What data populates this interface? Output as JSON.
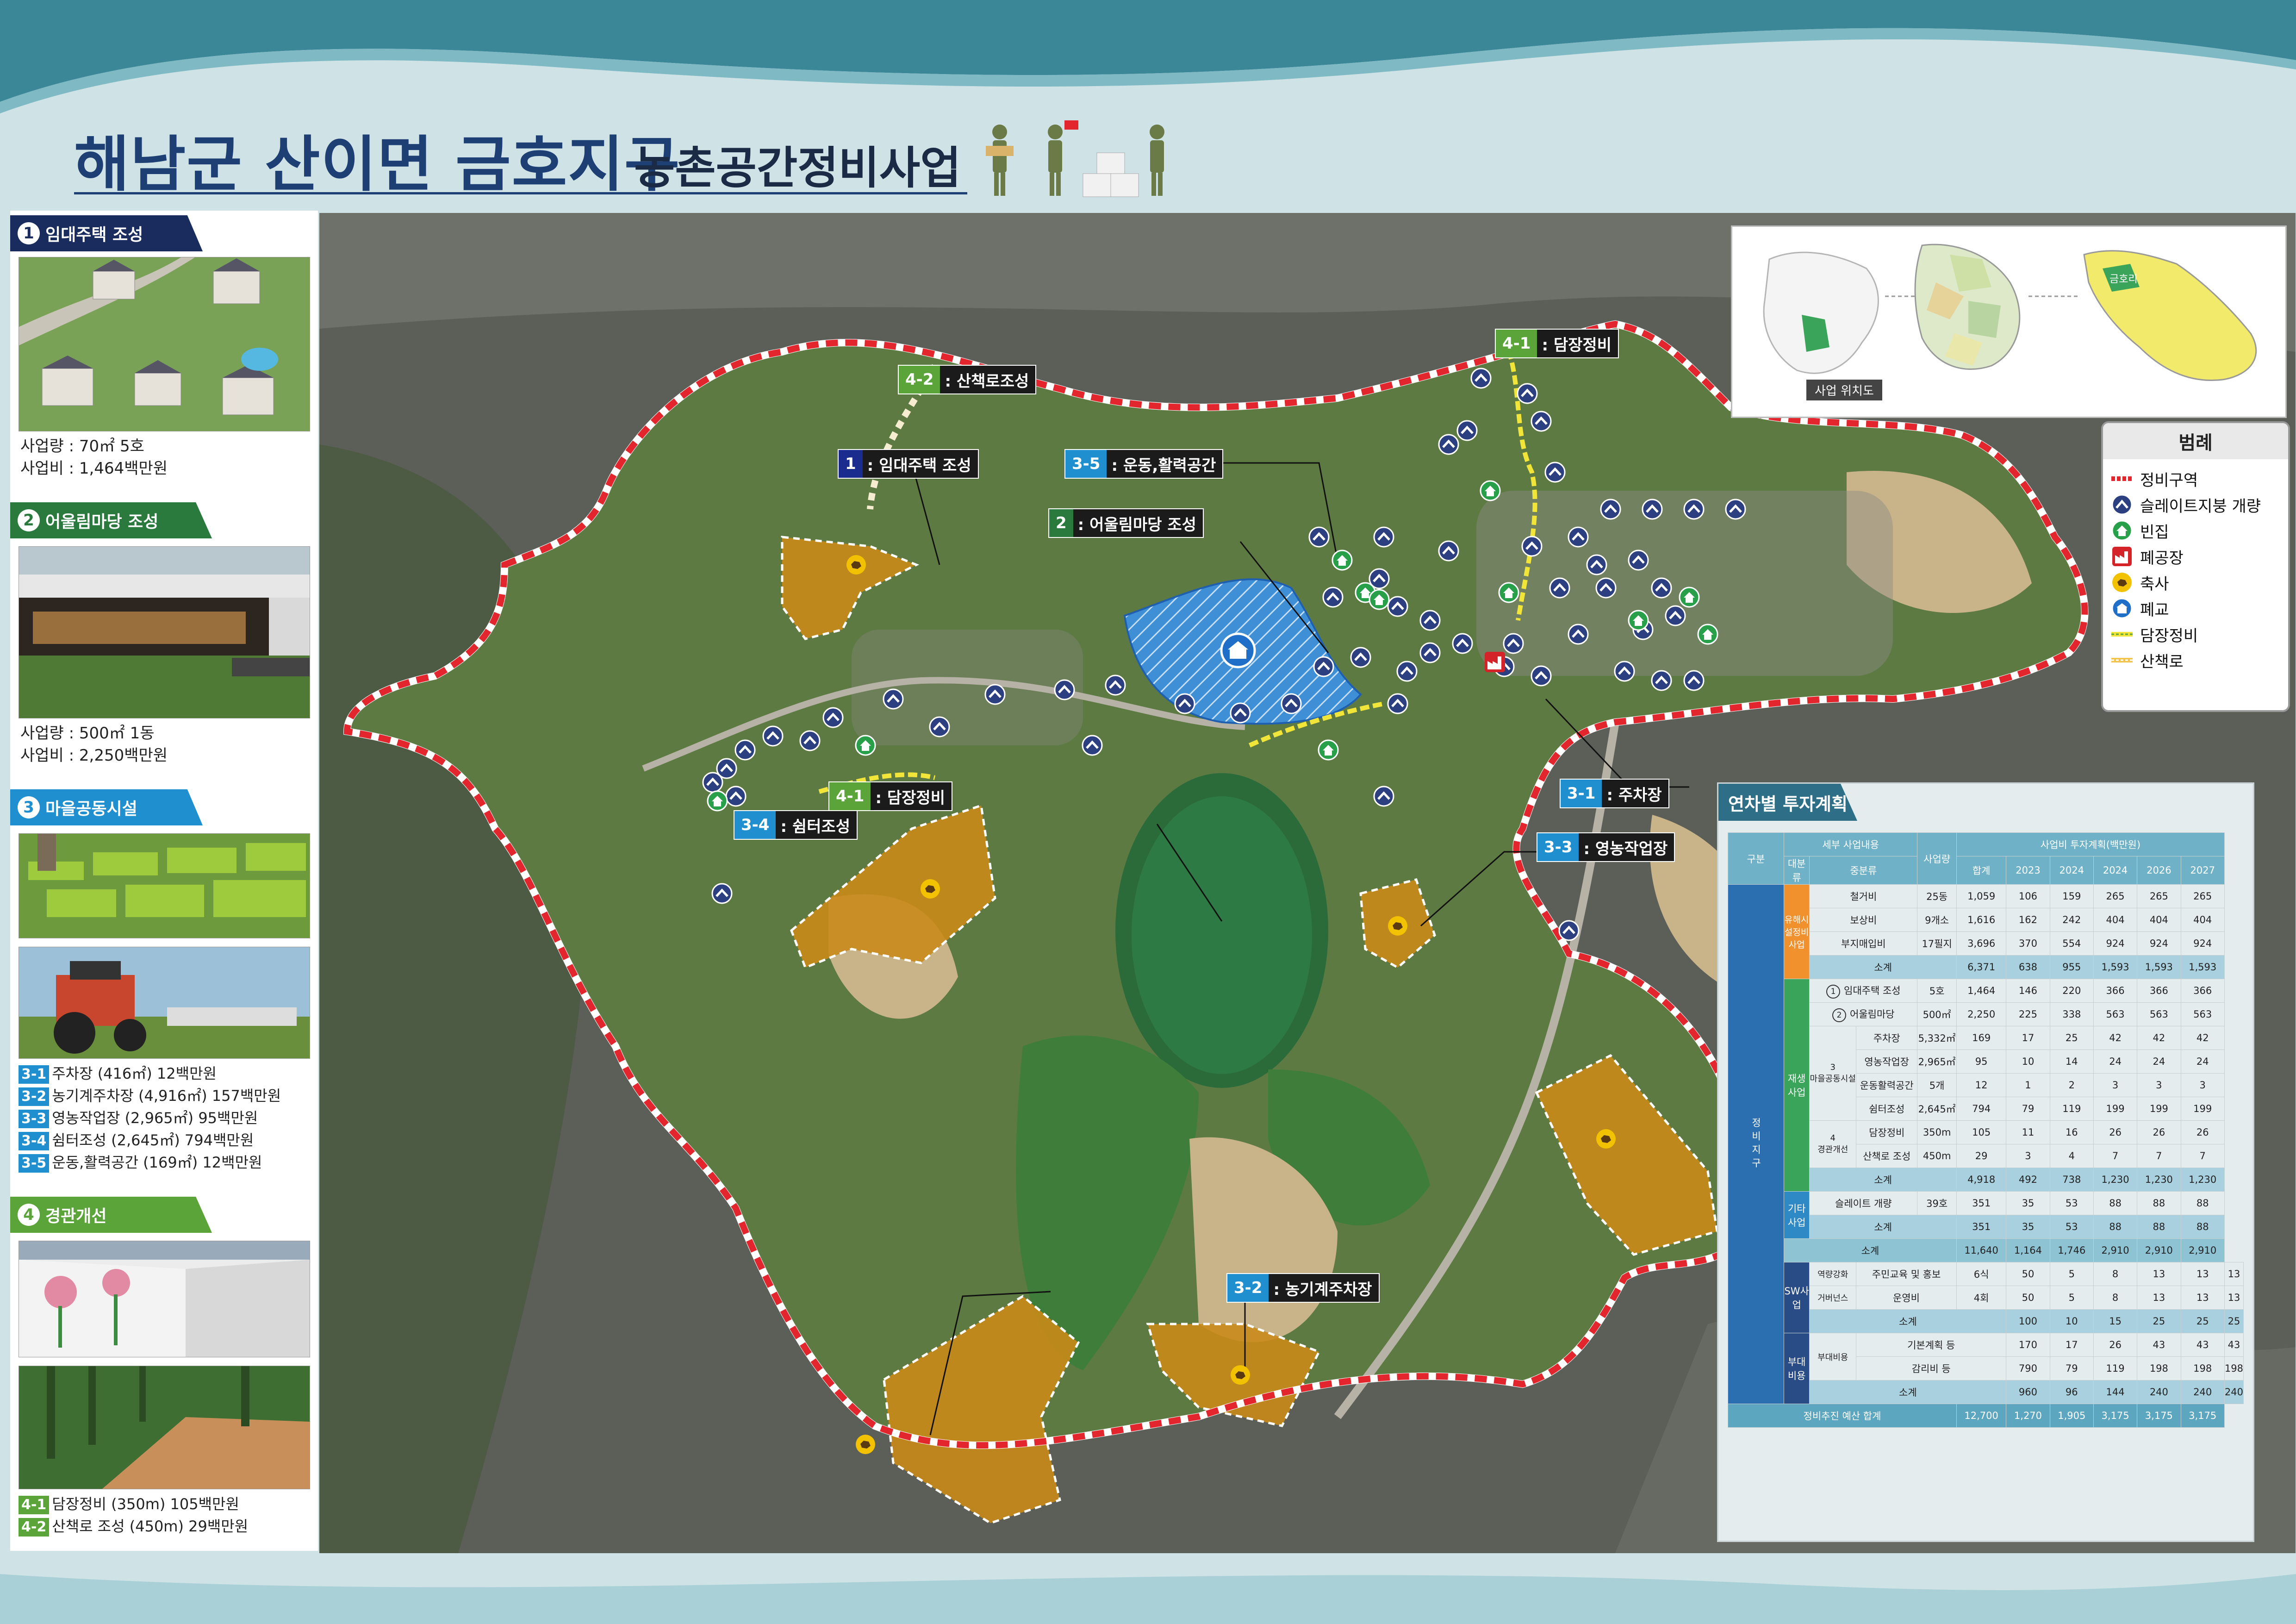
{
  "header": {
    "title_main": "해남군 산이면 금호지구",
    "title_sub": "농촌공간정비사업"
  },
  "left_panel": {
    "sec1": {
      "num": "1",
      "title": "임대주택 조성",
      "amount": "사업량 : 70㎡ 5호",
      "cost": "사업비 : 1,464백만원"
    },
    "sec2": {
      "num": "2",
      "title": "어울림마당 조성",
      "amount": "사업량 : 500㎡ 1동",
      "cost": "사업비 : 2,250백만원"
    },
    "sec3": {
      "num": "3",
      "title": "마을공동시설",
      "items": [
        {
          "tag": "3-1",
          "text": "주차장 (416㎡) 12백만원"
        },
        {
          "tag": "3-2",
          "text": "농기계주차장 (4,916㎡) 157백만원"
        },
        {
          "tag": "3-3",
          "text": "영농작업장 (2,965㎡) 95백만원"
        },
        {
          "tag": "3-4",
          "text": "쉼터조성 (2,645㎡) 794백만원"
        },
        {
          "tag": "3-5",
          "text": "운동,활력공간 (169㎡) 12백만원"
        }
      ]
    },
    "sec4": {
      "num": "4",
      "title": "경관개선",
      "items": [
        {
          "tag": "4-1",
          "text": "담장정비 (350m) 105백만원"
        },
        {
          "tag": "4-2",
          "text": "산책로 조성 (450m) 29백만원"
        }
      ]
    }
  },
  "map_labels": {
    "l42": {
      "n": "4-2",
      "t": ": 산책로조성"
    },
    "l41top": {
      "n": "4-1",
      "t": ": 담장정비"
    },
    "l1": {
      "n": "1",
      "t": ": 임대주택 조성"
    },
    "l35": {
      "n": "3-5",
      "t": ": 운동,활력공간"
    },
    "l2": {
      "n": "2",
      "t": ": 어울림마당 조성"
    },
    "l41": {
      "n": "4-1",
      "t": ": 담장정비"
    },
    "l34": {
      "n": "3-4",
      "t": ": 쉼터조성"
    },
    "l31": {
      "n": "3-1",
      "t": ": 주차장"
    },
    "l33": {
      "n": "3-3",
      "t": ": 영농작업장"
    },
    "l32": {
      "n": "3-2",
      "t": ": 농기계주차장"
    }
  },
  "inset": {
    "caption": "사업 위치도",
    "label": "금호리"
  },
  "legend": {
    "title": "범례",
    "items": [
      {
        "icon": "dashed-boundary-icon",
        "label": "정비구역"
      },
      {
        "icon": "slate-roof-icon",
        "label": "슬레이트지붕 개량"
      },
      {
        "icon": "empty-house-icon",
        "label": "빈집"
      },
      {
        "icon": "factory-icon",
        "label": "폐공장"
      },
      {
        "icon": "livestock-icon",
        "label": "축사"
      },
      {
        "icon": "school-icon",
        "label": "폐교"
      },
      {
        "icon": "wall-line-icon",
        "label": "담장정비"
      },
      {
        "icon": "trail-line-icon",
        "label": "산책로"
      }
    ]
  },
  "investment": {
    "title": "연차별 투자계획",
    "h_cat": "구분",
    "h_detail": "세부 사업내용",
    "h_major": "대분류",
    "h_minor": "중분류",
    "h_qty": "사업량",
    "h_plan": "사업비 투자계획(백만원)",
    "years": [
      "합계",
      "2023",
      "2024",
      "2024",
      "2026",
      "2027"
    ],
    "cat_main": "정비지구",
    "cat_harm": "유해시설정비사업",
    "cat_regen": "재생사업",
    "cat_other": "기타사업",
    "cat_sw": "SW사업",
    "cat_sub": "부대비용",
    "regen_village": "마을공동시설",
    "regen_landscape": "경관개선",
    "harm_rows": [
      {
        "name": "철거비",
        "qty": "25동",
        "v": [
          "1,059",
          "106",
          "159",
          "265",
          "265",
          "265"
        ]
      },
      {
        "name": "보상비",
        "qty": "9개소",
        "v": [
          "1,616",
          "162",
          "242",
          "404",
          "404",
          "404"
        ]
      },
      {
        "name": "부지매입비",
        "qty": "17필지",
        "v": [
          "3,696",
          "370",
          "554",
          "924",
          "924",
          "924"
        ]
      }
    ],
    "harm_sub": {
      "name": "소계",
      "v": [
        "6,371",
        "638",
        "955",
        "1,593",
        "1,593",
        "1,593"
      ]
    },
    "regen_rows": [
      {
        "no": "1",
        "name": "임대주택 조성",
        "qty": "5호",
        "v": [
          "1,464",
          "146",
          "220",
          "366",
          "366",
          "366"
        ]
      },
      {
        "no": "2",
        "name": "어울림마당",
        "qty": "500㎡",
        "v": [
          "2,250",
          "225",
          "338",
          "563",
          "563",
          "563"
        ]
      },
      {
        "no": "3",
        "name": "주차장",
        "qty": "5,332㎡",
        "v": [
          "169",
          "17",
          "25",
          "42",
          "42",
          "42"
        ]
      },
      {
        "no": "",
        "name": "영농작업장",
        "qty": "2,965㎡",
        "v": [
          "95",
          "10",
          "14",
          "24",
          "24",
          "24"
        ]
      },
      {
        "no": "",
        "name": "운동활력공간",
        "qty": "5개",
        "v": [
          "12",
          "1",
          "2",
          "3",
          "3",
          "3"
        ]
      },
      {
        "no": "",
        "name": "쉼터조성",
        "qty": "2,645㎡",
        "v": [
          "794",
          "79",
          "119",
          "199",
          "199",
          "199"
        ]
      },
      {
        "no": "4",
        "name": "담장정비",
        "qty": "350m",
        "v": [
          "105",
          "11",
          "16",
          "26",
          "26",
          "26"
        ]
      },
      {
        "no": "",
        "name": "산책로 조성",
        "qty": "450m",
        "v": [
          "29",
          "3",
          "4",
          "7",
          "7",
          "7"
        ]
      }
    ],
    "regen_sub": {
      "name": "소계",
      "v": [
        "4,918",
        "492",
        "738",
        "1,230",
        "1,230",
        "1,230"
      ]
    },
    "other_rows": [
      {
        "name": "슬레이트 개량",
        "qty": "39호",
        "v": [
          "351",
          "35",
          "53",
          "88",
          "88",
          "88"
        ]
      }
    ],
    "other_sub": {
      "name": "소계",
      "v": [
        "351",
        "35",
        "53",
        "88",
        "88",
        "88"
      ]
    },
    "total1": {
      "name": "소계",
      "v": [
        "11,640",
        "1,164",
        "1,746",
        "2,910",
        "2,910",
        "2,910"
      ]
    },
    "sw_rows": [
      {
        "major": "역량강화",
        "name": "주민교육 및 홍보",
        "qty": "6식",
        "v": [
          "50",
          "5",
          "8",
          "13",
          "13",
          "13"
        ]
      },
      {
        "major": "거버넌스",
        "name": "운영비",
        "qty": "4회",
        "v": [
          "50",
          "5",
          "8",
          "13",
          "13",
          "13"
        ]
      }
    ],
    "sw_sub": {
      "name": "소계",
      "v": [
        "100",
        "10",
        "15",
        "25",
        "25",
        "25"
      ]
    },
    "sub_major": "부대비용",
    "sub_rows": [
      {
        "name": "기본계획 등",
        "v": [
          "170",
          "17",
          "26",
          "43",
          "43",
          "43"
        ]
      },
      {
        "name": "감리비 등",
        "v": [
          "790",
          "79",
          "119",
          "198",
          "198",
          "198"
        ]
      }
    ],
    "sub_sub": {
      "name": "소계",
      "v": [
        "960",
        "96",
        "144",
        "240",
        "240",
        "240"
      ]
    },
    "grand": {
      "name": "정비추진 예산 합계",
      "v": [
        "12,700",
        "1,270",
        "1,905",
        "3,175",
        "3,175",
        "3,175"
      ]
    }
  },
  "colors": {
    "navy": "#1d3f74",
    "label_blue": "#1f8fd0",
    "label_green": "#5aa43a",
    "boundary_red": "#e3262e",
    "zone_orange": "#c98a1a"
  }
}
